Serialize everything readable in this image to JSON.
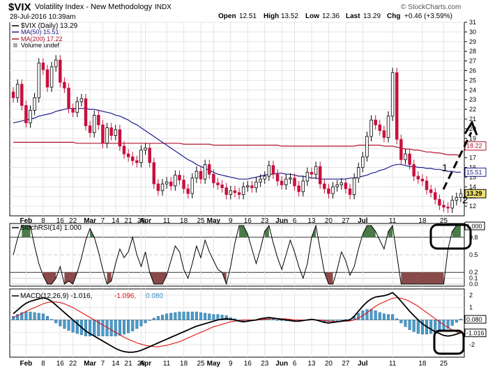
{
  "header": {
    "symbol": "$VIX",
    "name": "Volatility Index - New Methodology",
    "exchange": "INDX",
    "datetime": "28-Jul-2016 10:39am",
    "open_label": "Open",
    "open": "12.51",
    "high_label": "High",
    "high": "13.52",
    "low_label": "Low",
    "low": "12.36",
    "last_label": "Last",
    "last": "13.29",
    "chg_label": "Chg",
    "chg": "+0.46 (+3.59%)",
    "watermark": "© StockCharts.com"
  },
  "colors": {
    "up_candle": "#000000",
    "down_candle": "#c8103c",
    "ma50": "#1c1c8c",
    "ma200": "#b0102a",
    "stoch_fill_high": "#4a7a4a",
    "stoch_fill_low": "#8a4a4a",
    "macd_hist": "#4a9ac8",
    "signal": "#e01010",
    "last_tag": "#f0e070"
  },
  "chart_data": [
    {
      "type": "candlestick",
      "title": "$VIX (Daily) 13.29",
      "legend": [
        {
          "label": "$VIX (Daily) 13.29"
        },
        {
          "label": "MA(50) 15.51"
        },
        {
          "label": "MA(200) 17.22"
        },
        {
          "label": "Volume undef"
        }
      ],
      "ylim": [
        11,
        31
      ],
      "yticks": [
        12,
        13,
        14,
        15,
        16,
        17,
        18,
        19,
        20,
        21,
        22,
        23,
        24,
        25,
        26,
        27,
        28,
        29,
        30,
        31
      ],
      "x_ticks": [
        "Feb",
        "8",
        "16",
        "22",
        "Mar",
        "7",
        "14",
        "21",
        "28",
        "Apr",
        "11",
        "18",
        "25",
        "May",
        "9",
        "16",
        "23",
        "Jun",
        "6",
        "13",
        "20",
        "27",
        "Jul",
        "11",
        "18",
        "25"
      ],
      "closes": [
        23.2,
        24.6,
        22.4,
        20.6,
        21.9,
        23.2,
        26.8,
        26.1,
        24.3,
        26.4,
        27.1,
        24.8,
        24.2,
        22.1,
        21.7,
        22.8,
        23.1,
        20.3,
        19.6,
        21.4,
        20.4,
        18.5,
        20.1,
        19.3,
        19.9,
        18.2,
        17.4,
        17.1,
        16.7,
        16.5,
        17.8,
        18.0,
        16.5,
        14.3,
        13.6,
        14.3,
        14.5,
        14.1,
        15.2,
        14.7,
        13.8,
        13.3,
        14.9,
        15.6,
        14.8,
        16.3,
        15.3,
        14.4,
        14.2,
        13.9,
        13.2,
        13.6,
        13.4,
        13.2,
        14.0,
        14.1,
        13.9,
        14.5,
        14.8,
        15.1,
        16.2,
        15.3,
        14.6,
        14.2,
        14.8,
        14.9,
        14.1,
        13.5,
        14.6,
        15.5,
        15.3,
        16.1,
        14.3,
        13.8,
        13.3,
        14.0,
        14.2,
        14.4,
        13.8,
        13.2,
        14.9,
        16.0,
        17.1,
        19.2,
        20.9,
        20.4,
        19.8,
        19.1,
        21.3,
        25.8,
        18.9,
        16.8,
        17.4,
        16.3,
        15.1,
        14.8,
        14.6,
        13.7,
        13.4,
        12.7,
        12.1,
        11.9,
        11.8,
        12.6,
        12.9,
        13.3
      ],
      "ma50": [
        20.6,
        20.7,
        20.8,
        20.9,
        21.0,
        21.1,
        21.3,
        21.4,
        21.5,
        21.6,
        21.8,
        21.9,
        22.0,
        22.1,
        22.1,
        22.1,
        22.1,
        22.1,
        22.0,
        22.0,
        21.9,
        21.8,
        21.7,
        21.6,
        21.4,
        21.3,
        21.1,
        20.9,
        20.6,
        20.4,
        20.1,
        19.8,
        19.5,
        19.2,
        18.9,
        18.6,
        18.3,
        18.0,
        17.7,
        17.4,
        17.1,
        16.8,
        16.6,
        16.3,
        16.1,
        15.9,
        15.7,
        15.5,
        15.3,
        15.2,
        15.1,
        15.0,
        14.9,
        14.8,
        14.8,
        14.8,
        14.9,
        15.0,
        15.1,
        15.2,
        15.3,
        15.3,
        15.4,
        15.4,
        15.3,
        15.3,
        15.2,
        15.1,
        15.1,
        15.0,
        14.9,
        14.9,
        14.8,
        14.8,
        14.8,
        14.8,
        14.8,
        14.8,
        14.8,
        14.9,
        14.9,
        15.0,
        15.1,
        15.2,
        15.4,
        15.5,
        15.7,
        15.8,
        16.0,
        16.2,
        16.3,
        16.3,
        16.2,
        16.1,
        16.1,
        16.0,
        16.0,
        15.9,
        15.9,
        15.8,
        15.8,
        15.7,
        15.6,
        15.6,
        15.5,
        15.5
      ],
      "ma200": [
        18.6,
        18.6,
        18.6,
        18.6,
        18.6,
        18.6,
        18.6,
        18.6,
        18.6,
        18.6,
        18.6,
        18.6,
        18.6,
        18.6,
        18.6,
        18.5,
        18.5,
        18.5,
        18.5,
        18.5,
        18.5,
        18.5,
        18.5,
        18.5,
        18.5,
        18.5,
        18.5,
        18.5,
        18.5,
        18.5,
        18.5,
        18.5,
        18.5,
        18.5,
        18.5,
        18.5,
        18.5,
        18.5,
        18.5,
        18.5,
        18.4,
        18.4,
        18.4,
        18.4,
        18.4,
        18.4,
        18.4,
        18.3,
        18.3,
        18.3,
        18.3,
        18.3,
        18.3,
        18.3,
        18.3,
        18.3,
        18.3,
        18.3,
        18.3,
        18.3,
        18.3,
        18.3,
        18.3,
        18.2,
        18.2,
        18.2,
        18.2,
        18.2,
        18.2,
        18.2,
        18.2,
        18.2,
        18.2,
        18.2,
        18.2,
        18.2,
        18.2,
        18.2,
        18.2,
        18.2,
        18.2,
        18.3,
        18.3,
        18.3,
        18.3,
        18.3,
        18.3,
        18.2,
        18.2,
        18.2,
        18.1,
        18.0,
        17.9,
        17.9,
        17.8,
        17.8,
        17.7,
        17.6,
        17.6,
        17.5,
        17.5,
        17.4,
        17.3,
        17.3,
        17.3,
        17.2
      ],
      "right_tags": [
        {
          "label": "18.22",
          "value": 18.22
        },
        {
          "label": "15.51",
          "value": 15.51
        },
        {
          "label": "13.29",
          "value": 13.29
        }
      ],
      "annotations": [
        {
          "label": "1"
        },
        {
          "label": "2"
        }
      ]
    },
    {
      "type": "line",
      "title": "StochRSI(14) 1.000",
      "ylim": [
        0,
        1
      ],
      "yticks": [
        0.0,
        0.1,
        0.2,
        0.5,
        0.8,
        1.0
      ],
      "upper_threshold": 0.8,
      "lower_threshold": 0.2,
      "right_tag": "1.000",
      "values": [
        0.5,
        0.78,
        1.0,
        1.0,
        1.0,
        0.65,
        0.35,
        0.15,
        0.0,
        0.0,
        0.1,
        0.3,
        0.0,
        0.05,
        0.0,
        0.2,
        0.45,
        0.75,
        0.95,
        0.8,
        0.55,
        0.25,
        0.0,
        0.05,
        0.35,
        0.6,
        0.45,
        0.55,
        0.8,
        0.5,
        0.3,
        0.55,
        0.2,
        0.0,
        0.0,
        0.0,
        0.15,
        0.4,
        0.65,
        0.55,
        0.25,
        0.1,
        0.35,
        0.65,
        0.45,
        0.75,
        0.55,
        0.4,
        0.25,
        0.2,
        0.0,
        0.3,
        0.7,
        1.0,
        1.0,
        0.85,
        0.6,
        0.35,
        0.6,
        0.9,
        1.0,
        0.7,
        0.45,
        0.25,
        0.5,
        0.75,
        0.55,
        0.3,
        0.1,
        0.35,
        0.8,
        1.0,
        0.6,
        0.2,
        0.0,
        0.0,
        0.25,
        0.55,
        0.4,
        0.15,
        0.3,
        0.6,
        0.85,
        1.0,
        1.0,
        0.9,
        0.75,
        0.6,
        0.9,
        1.0,
        0.5,
        0.0,
        0.0,
        0.0,
        0.0,
        0.0,
        0.0,
        0.0,
        0.0,
        0.0,
        0.0,
        0.0,
        0.6,
        0.9,
        1.0,
        1.0
      ]
    },
    {
      "type": "line",
      "title": "MACD(12,26,9)",
      "legend": [
        {
          "label": "MACD(12,26,9) -1.016,"
        },
        {
          "label": "-1.096,"
        },
        {
          "label": "0.080"
        }
      ],
      "ylim": [
        -3,
        2.5
      ],
      "yticks": [
        2,
        1,
        0,
        -1,
        -2
      ],
      "right_tags": [
        {
          "label": "0.080",
          "value": 0.08
        },
        {
          "label": "-1.016",
          "value": -1.016
        }
      ],
      "macd": [
        0.5,
        0.8,
        1.1,
        1.35,
        1.5,
        1.6,
        1.7,
        1.8,
        1.7,
        1.5,
        1.2,
        0.9,
        0.6,
        0.3,
        0.0,
        -0.3,
        -0.6,
        -0.9,
        -1.1,
        -1.3,
        -1.5,
        -1.7,
        -1.9,
        -2.1,
        -2.3,
        -2.45,
        -2.55,
        -2.6,
        -2.6,
        -2.55,
        -2.45,
        -2.3,
        -2.15,
        -2.0,
        -1.85,
        -1.7,
        -1.55,
        -1.4,
        -1.25,
        -1.1,
        -0.95,
        -0.8,
        -0.65,
        -0.5,
        -0.4,
        -0.3,
        -0.2,
        -0.1,
        0.0,
        0.05,
        0.1,
        0.05,
        0.0,
        -0.1,
        -0.15,
        -0.1,
        -0.05,
        0.0,
        0.1,
        0.15,
        0.2,
        0.15,
        0.1,
        0.05,
        0.0,
        -0.05,
        -0.1,
        -0.1,
        -0.05,
        0.0,
        0.05,
        0.0,
        -0.1,
        -0.2,
        -0.25,
        -0.2,
        -0.15,
        -0.1,
        -0.05,
        0.0,
        0.3,
        0.7,
        1.1,
        1.45,
        1.7,
        1.85,
        1.9,
        1.95,
        2.05,
        2.2,
        1.9,
        1.5,
        1.1,
        0.7,
        0.35,
        0.0,
        -0.3,
        -0.55,
        -0.75,
        -0.95,
        -1.1,
        -1.25,
        -1.3,
        -1.25,
        -1.15,
        -1.016
      ],
      "signal": [
        0.2,
        0.35,
        0.5,
        0.7,
        0.85,
        1.0,
        1.15,
        1.3,
        1.4,
        1.45,
        1.45,
        1.4,
        1.3,
        1.15,
        1.0,
        0.8,
        0.6,
        0.4,
        0.2,
        0.0,
        -0.2,
        -0.4,
        -0.6,
        -0.8,
        -1.0,
        -1.2,
        -1.4,
        -1.55,
        -1.7,
        -1.85,
        -1.95,
        -2.05,
        -2.1,
        -2.15,
        -2.15,
        -2.1,
        -2.05,
        -1.95,
        -1.85,
        -1.75,
        -1.6,
        -1.45,
        -1.3,
        -1.15,
        -1.0,
        -0.85,
        -0.7,
        -0.55,
        -0.45,
        -0.35,
        -0.25,
        -0.15,
        -0.1,
        -0.05,
        0.0,
        0.0,
        0.0,
        0.0,
        0.0,
        0.05,
        0.1,
        0.1,
        0.1,
        0.1,
        0.08,
        0.05,
        0.0,
        0.0,
        -0.02,
        -0.02,
        0.0,
        0.0,
        0.0,
        -0.05,
        -0.1,
        -0.12,
        -0.12,
        -0.12,
        -0.1,
        -0.08,
        0.0,
        0.15,
        0.35,
        0.6,
        0.85,
        1.1,
        1.3,
        1.45,
        1.6,
        1.75,
        1.8,
        1.75,
        1.65,
        1.5,
        1.3,
        1.1,
        0.85,
        0.6,
        0.35,
        0.1,
        -0.15,
        -0.4,
        -0.6,
        -0.8,
        -0.95,
        -1.096
      ]
    }
  ]
}
